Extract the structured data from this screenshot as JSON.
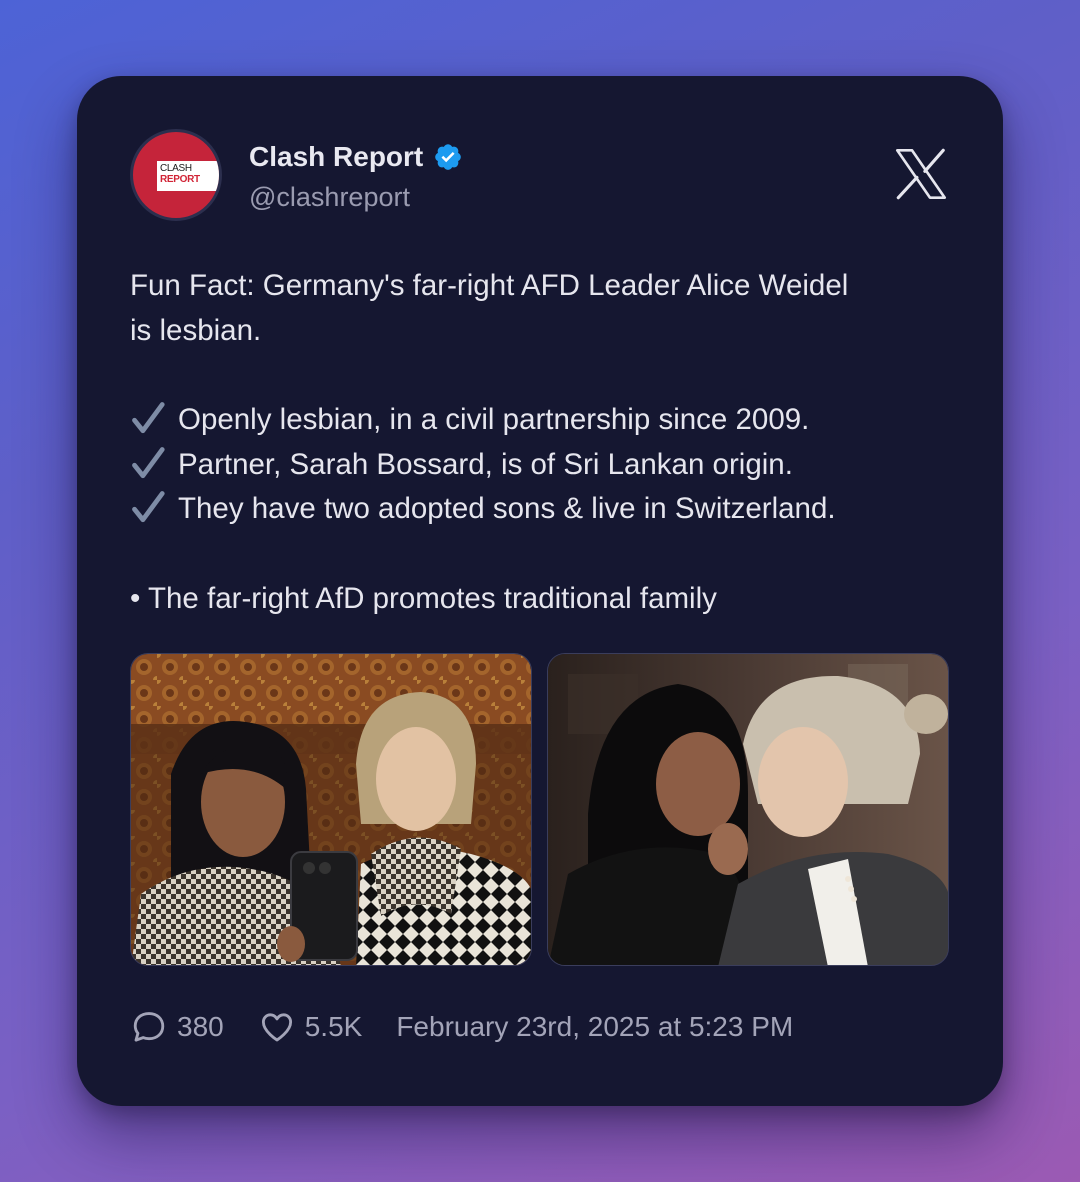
{
  "author": {
    "name": "Clash Report",
    "handle": "@clashreport",
    "verified": true,
    "avatar_logo_line1": "CLASH",
    "avatar_logo_line2": "REPORT",
    "avatar_color": "#c5243a"
  },
  "platform_icon": "x-logo-icon",
  "tweet": {
    "line1": "Fun Fact: Germany's far-right AFD Leader Alice Weidel",
    "line2": "is lesbian.",
    "bullets": [
      "Openly lesbian, in a civil partnership since 2009.",
      "Partner, Sarah Bossard, is of Sri Lankan origin.",
      "They have two adopted sons & live in Switzerland."
    ],
    "bullet_icon": "check-mark-icon",
    "closing": "• The far-right AfD promotes traditional family"
  },
  "media": [
    {
      "name": "photo-selfie"
    },
    {
      "name": "photo-event"
    }
  ],
  "stats": {
    "replies": "380",
    "reply_icon": "comment-bubble-icon",
    "likes": "5.5K",
    "like_icon": "heart-icon",
    "timestamp": "February 23rd, 2025 at 5:23 PM"
  },
  "colors": {
    "card_background": "#151731",
    "verified_badge": "#1d9bf0",
    "text_primary": "#e6e6ee",
    "text_secondary": "#9a9bb0"
  }
}
